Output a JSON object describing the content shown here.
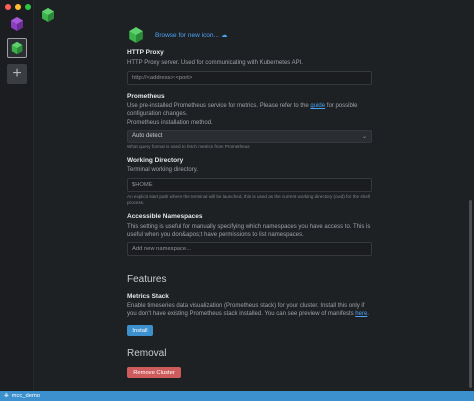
{
  "window": {
    "controls": [
      "close",
      "minimize",
      "maximize"
    ]
  },
  "sidebar": {
    "items": [
      {
        "name": "cluster-1",
        "icon": "cluster-hex-icon",
        "color": "#8a3fbf"
      },
      {
        "name": "cluster-2",
        "icon": "cluster-hex-icon",
        "color": "#3bb34a",
        "selected": true
      },
      {
        "name": "add-cluster",
        "icon": "plus-icon",
        "label": "+"
      }
    ]
  },
  "settings": {
    "icon_browse": "Browse for new icon...",
    "http_proxy": {
      "label": "HTTP Proxy",
      "description": "HTTP Proxy server. Used for communicating with Kubernetes API.",
      "placeholder": "http://<address>:<port>"
    },
    "prometheus": {
      "label": "Prometheus",
      "description_pre": "Use pre-installed Prometheus service for metrics. Please refer to the ",
      "description_link": "guide",
      "description_post": " for possible configuration changes.",
      "method_text": "Prometheus installation method.",
      "selected": "Auto detect",
      "hint": "What query format is used to fetch metrics from Prometheus"
    },
    "working_directory": {
      "label": "Working Directory",
      "description": "Terminal working directory.",
      "value": "$HOME",
      "hint": "An explicit start path where the terminal will be launched, this is used as the current working directory (cwd) for the shell process."
    },
    "namespaces": {
      "label": "Accessible Namespaces",
      "description": "This setting is useful for manually specifying which namespaces you have access to. This is useful when you don&apos;t have permissions to list namespaces.",
      "placeholder": "Add new namespace..."
    }
  },
  "features": {
    "heading": "Features",
    "metrics_stack": {
      "label": "Metrics Stack",
      "description_pre": "Enable timeseries data visualization (Prometheus stack) for your cluster. Install this only if you don't have existing Prometheus stack installed. You can see preview of manifests ",
      "description_link": "here",
      "description_post": ".",
      "button": "Install"
    }
  },
  "removal": {
    "heading": "Removal",
    "button": "Remove Cluster"
  },
  "status_bar": {
    "text": "mcc_demo"
  },
  "colors": {
    "accent": "#3d90ce",
    "danger": "#cf5c5c",
    "link": "#4aa3f5"
  }
}
